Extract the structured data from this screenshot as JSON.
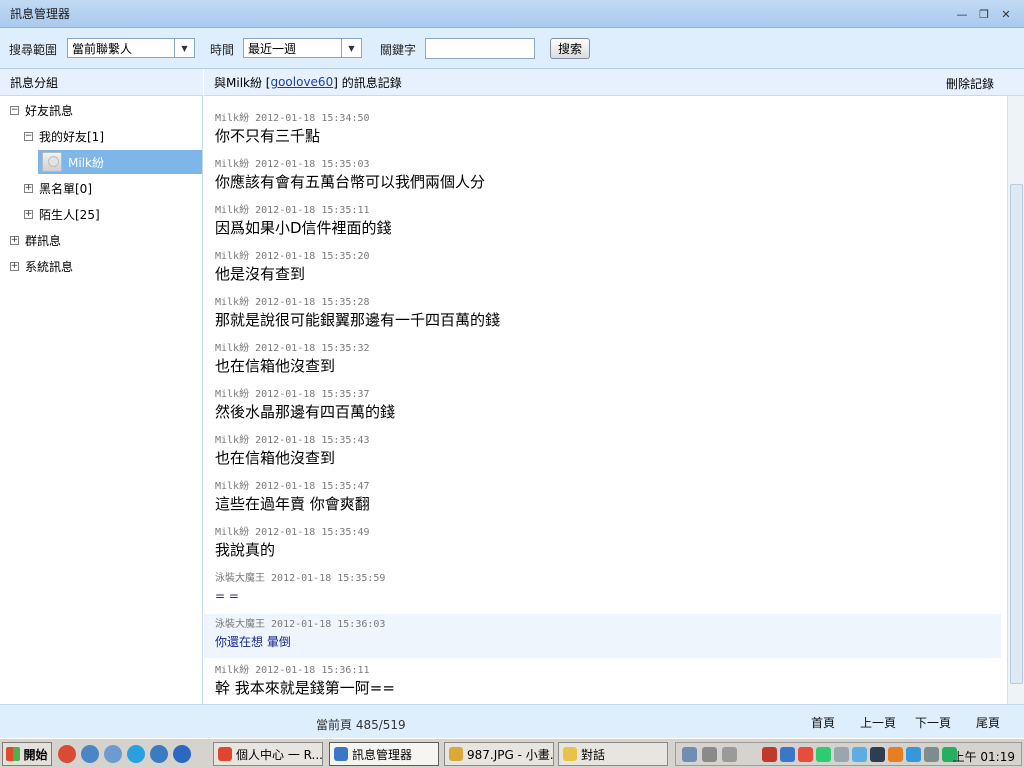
{
  "window": {
    "title": "訊息管理器"
  },
  "search": {
    "scope_label": "搜尋範圍",
    "scope_value": "當前聯繫人",
    "time_label": "時間",
    "time_value": "最近一週",
    "keyword_label": "關鍵字",
    "keyword_value": "",
    "search_button": "搜索"
  },
  "sidebar": {
    "header": "訊息分組",
    "tree": {
      "friends_msg": "好友訊息",
      "my_friends": "我的好友[1]",
      "contact": "Milk紛",
      "blacklist": "黑名單[0]",
      "strangers": "陌生人[25]",
      "group_msg": "群訊息",
      "system_msg": "系統訊息"
    }
  },
  "main": {
    "header_prefix": "與Milk紛 [",
    "header_account": "goolove60",
    "header_suffix": "] 的訊息記錄",
    "delete_label": "刪除記錄",
    "messages": [
      {
        "sender": "Milk紛",
        "time": "2012-01-18 15:34:50",
        "text": "你不只有三千點"
      },
      {
        "sender": "Milk紛",
        "time": "2012-01-18 15:35:03",
        "text": "你應該有會有五萬台幣可以我們兩個人分"
      },
      {
        "sender": "Milk紛",
        "time": "2012-01-18 15:35:11",
        "text": "因爲如果小D信件裡面的錢"
      },
      {
        "sender": "Milk紛",
        "time": "2012-01-18 15:35:20",
        "text": "他是沒有查到"
      },
      {
        "sender": "Milk紛",
        "time": "2012-01-18 15:35:28",
        "text": "那就是說很可能銀翼那邊有一千四百萬的錢"
      },
      {
        "sender": "Milk紛",
        "time": "2012-01-18 15:35:32",
        "text": "也在信箱他沒查到"
      },
      {
        "sender": "Milk紛",
        "time": "2012-01-18 15:35:37",
        "text": "然後水晶那邊有四百萬的錢"
      },
      {
        "sender": "Milk紛",
        "time": "2012-01-18 15:35:43",
        "text": "也在信箱他沒查到"
      },
      {
        "sender": "Milk紛",
        "time": "2012-01-18 15:35:47",
        "text": "這些在過年賣 你會爽翻"
      },
      {
        "sender": "Milk紛",
        "time": "2012-01-18 15:35:49",
        "text": "我說真的"
      },
      {
        "sender": "泳裝大魔王",
        "time": "2012-01-18 15:35:59",
        "text": "= ="
      },
      {
        "sender": "泳裝大魔王",
        "time": "2012-01-18 15:36:03",
        "text": "你還在想 暈倒"
      },
      {
        "sender": "Milk紛",
        "time": "2012-01-18 15:36:11",
        "text": "幹 我本來就是錢第一阿=="
      }
    ]
  },
  "footer": {
    "page_info": "當前頁 485/519",
    "first": "首頁",
    "prev": "上一頁",
    "next": "下一頁",
    "last": "尾頁"
  },
  "taskbar": {
    "start": "開始",
    "tasks": [
      {
        "label": "個人中心 一 R...",
        "icon_color": "#e0452f"
      },
      {
        "label": "訊息管理器",
        "icon_color": "#3a77c8"
      },
      {
        "label": "987.JPG - 小畫...",
        "icon_color": "#d9a93a"
      },
      {
        "label": "對話",
        "icon_color": "#e8c24a"
      }
    ],
    "clock": "上午 01:19"
  }
}
